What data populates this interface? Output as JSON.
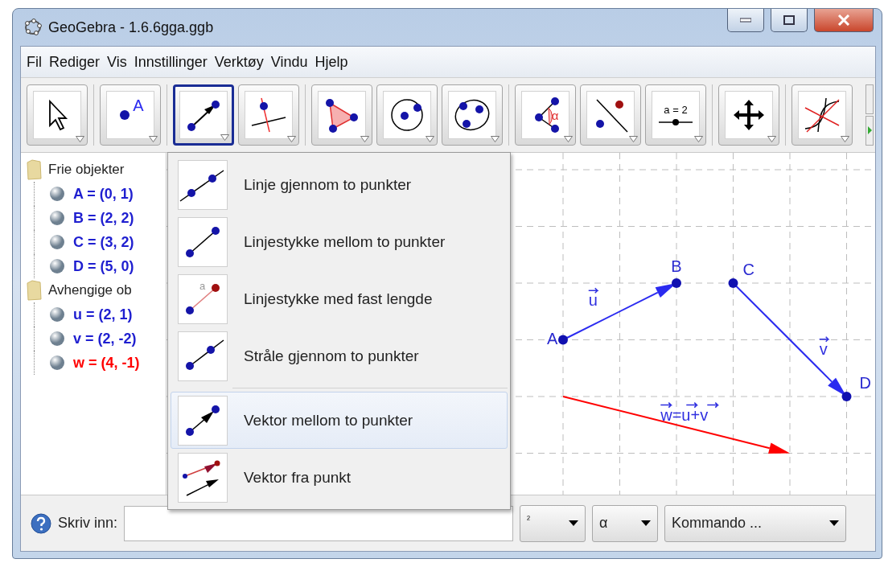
{
  "window": {
    "title": "GeoGebra - 1.6.6gga.ggb"
  },
  "menu": [
    "Fil",
    "Rediger",
    "Vis",
    "Innstillinger",
    "Verktøy",
    "Vindu",
    "Hjelp"
  ],
  "toolbar": {
    "groups": [
      [
        {
          "kind": "move",
          "selected": false
        }
      ],
      [
        {
          "kind": "point",
          "label": "A",
          "selected": false
        }
      ],
      [
        {
          "kind": "vector",
          "selected": true
        },
        {
          "kind": "perpendicular",
          "selected": false
        }
      ],
      [
        {
          "kind": "polygon",
          "selected": false
        },
        {
          "kind": "circle",
          "selected": false
        },
        {
          "kind": "ellipse",
          "selected": false
        }
      ],
      [
        {
          "kind": "angle",
          "label": "α",
          "selected": false
        },
        {
          "kind": "reflect",
          "selected": false
        },
        {
          "kind": "slider",
          "label": "a = 2",
          "selected": false
        }
      ],
      [
        {
          "kind": "move_view",
          "selected": false
        }
      ],
      [
        {
          "kind": "function",
          "selected": false
        }
      ]
    ]
  },
  "algebra": [
    {
      "label": "Frie objekter",
      "children": [
        {
          "text": "A = (0, 1)",
          "color": "#1f1fd0"
        },
        {
          "text": "B = (2, 2)",
          "color": "#1f1fd0"
        },
        {
          "text": "C = (3, 2)",
          "color": "#1f1fd0"
        },
        {
          "text": "D = (5, 0)",
          "color": "#1f1fd0"
        }
      ]
    },
    {
      "label": "Avhengige ob",
      "children": [
        {
          "text": "u = (2, 1)",
          "color": "#1f1fd0"
        },
        {
          "text": "v = (2, -2)",
          "color": "#1f1fd0"
        },
        {
          "text": "w = (4, -1)",
          "color": "#ff0000"
        }
      ]
    }
  ],
  "graphics": {
    "points": [
      {
        "label": "A"
      },
      {
        "label": "B"
      },
      {
        "label": "C"
      },
      {
        "label": "D"
      }
    ],
    "vectors": [
      {
        "label": "u",
        "color": "#2a2af0"
      },
      {
        "label": "v",
        "color": "#2a2af0"
      },
      {
        "label": "w=u+v",
        "color": "#ff0000"
      }
    ]
  },
  "dropdown": {
    "sections": [
      [
        {
          "kind": "line",
          "label": "Linje gjennom to punkter",
          "selected": false
        },
        {
          "kind": "segment",
          "label": "Linjestykke mellom to punkter",
          "selected": false
        },
        {
          "kind": "segment_fixed",
          "icon_label": "a",
          "label": "Linjestykke med fast lengde",
          "selected": false
        },
        {
          "kind": "ray",
          "label": "Stråle gjennom to punkter",
          "selected": false
        }
      ],
      [
        {
          "kind": "vector",
          "label": "Vektor mellom to punkter",
          "selected": true
        },
        {
          "kind": "vector_from_point",
          "label": "Vektor fra punkt",
          "selected": false
        }
      ]
    ]
  },
  "input_bar": {
    "label": "Skriv inn:",
    "dropdowns": [
      "²",
      "α",
      "Kommando ..."
    ]
  }
}
